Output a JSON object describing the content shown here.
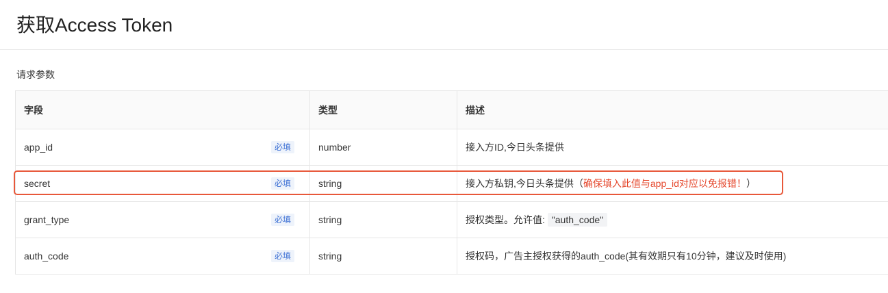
{
  "page": {
    "title": "获取Access Token",
    "section_label": "请求参数"
  },
  "table": {
    "headers": [
      "字段",
      "类型",
      "描述"
    ],
    "required_label": "必填",
    "rows": [
      {
        "field": "app_id",
        "type": "number",
        "desc": "接入方ID,今日头条提供"
      },
      {
        "field": "secret",
        "type": "string",
        "desc_prefix": "接入方私钥,今日头条提供（",
        "desc_warning": "确保填入此值与app_id对应以免报错！",
        "desc_suffix": "）"
      },
      {
        "field": "grant_type",
        "type": "string",
        "desc_prefix": "授权类型。允许值: ",
        "desc_code": "\"auth_code\""
      },
      {
        "field": "auth_code",
        "type": "string",
        "desc": "授权码，广告主授权获得的auth_code(其有效期只有10分钟，建议及时使用)"
      }
    ]
  },
  "colors": {
    "highlight": "#e8583a",
    "warning_text": "#e5482d",
    "badge_text": "#3b6fd4"
  }
}
